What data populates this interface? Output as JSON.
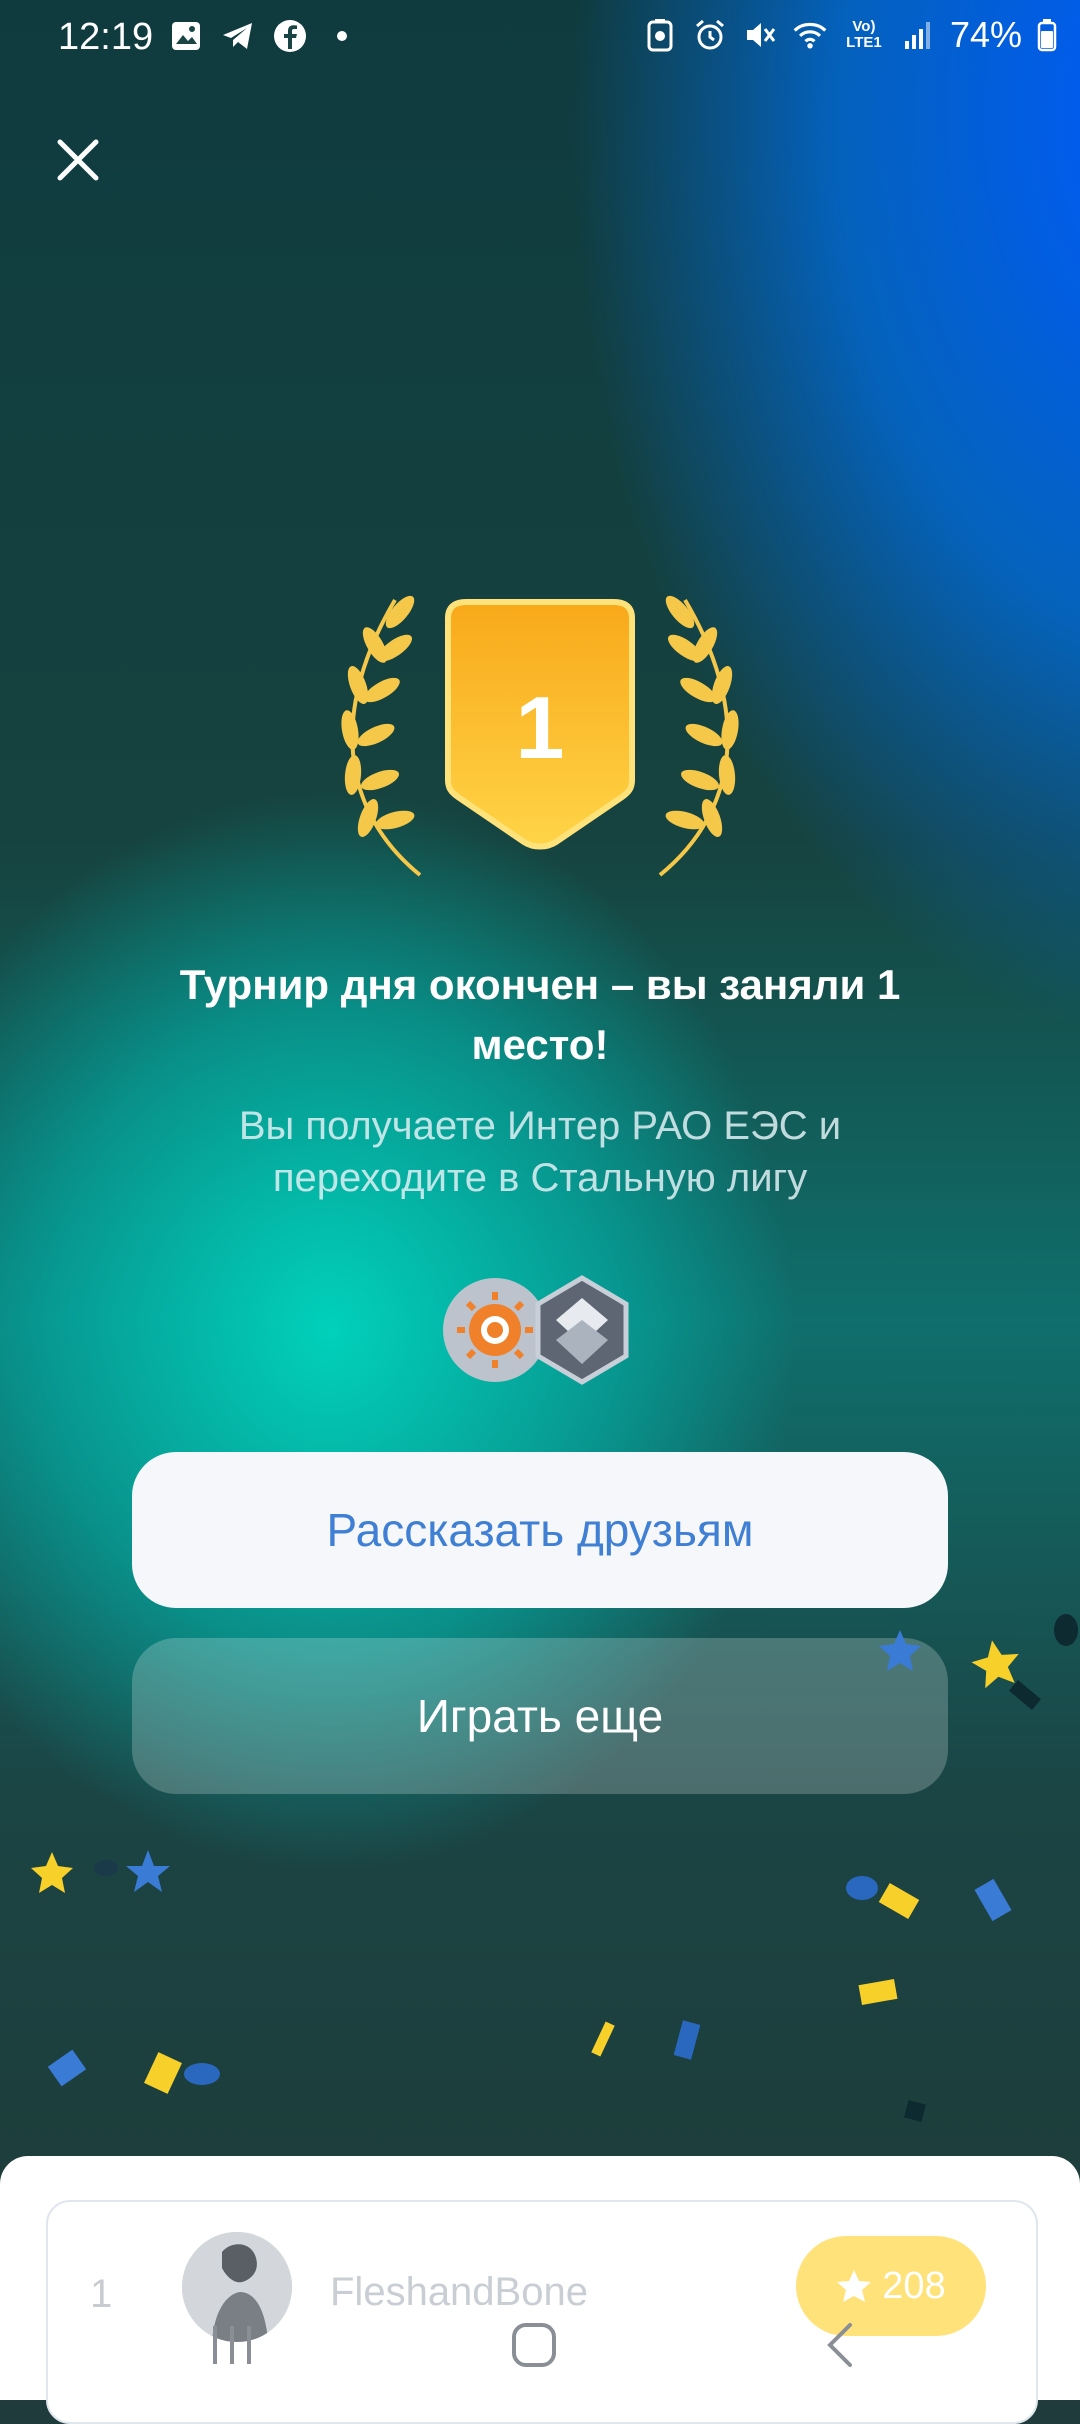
{
  "status_bar": {
    "time": "12:19",
    "battery": "74%",
    "network_label": "Vo) LTE1",
    "icons_left": [
      "gallery-icon",
      "telegram-icon",
      "facebook-icon",
      "dot-icon"
    ],
    "icons_right": [
      "battery-saver-icon",
      "alarm-icon",
      "mute-icon",
      "wifi-icon",
      "lte-icon",
      "signal-icon",
      "battery-icon"
    ]
  },
  "badge": {
    "place": "1"
  },
  "result": {
    "title": "Турнир дня окончен – вы заняли 1 место!",
    "subtitle": "Вы получаете Интер РАО ЕЭС и переходите в Стальную лигу"
  },
  "actions": {
    "share_label": "Рассказать друзьям",
    "play_again_label": "Играть еще"
  },
  "leaderboard": {
    "rows": [
      {
        "rank": "1",
        "name": "FleshandBone",
        "score": "208"
      }
    ]
  },
  "colors": {
    "accent_blue": "#3f7fd4",
    "gold": "#f6b31c",
    "confetti_yellow": "#f7d02a",
    "confetti_blue": "#3a7bd5"
  }
}
